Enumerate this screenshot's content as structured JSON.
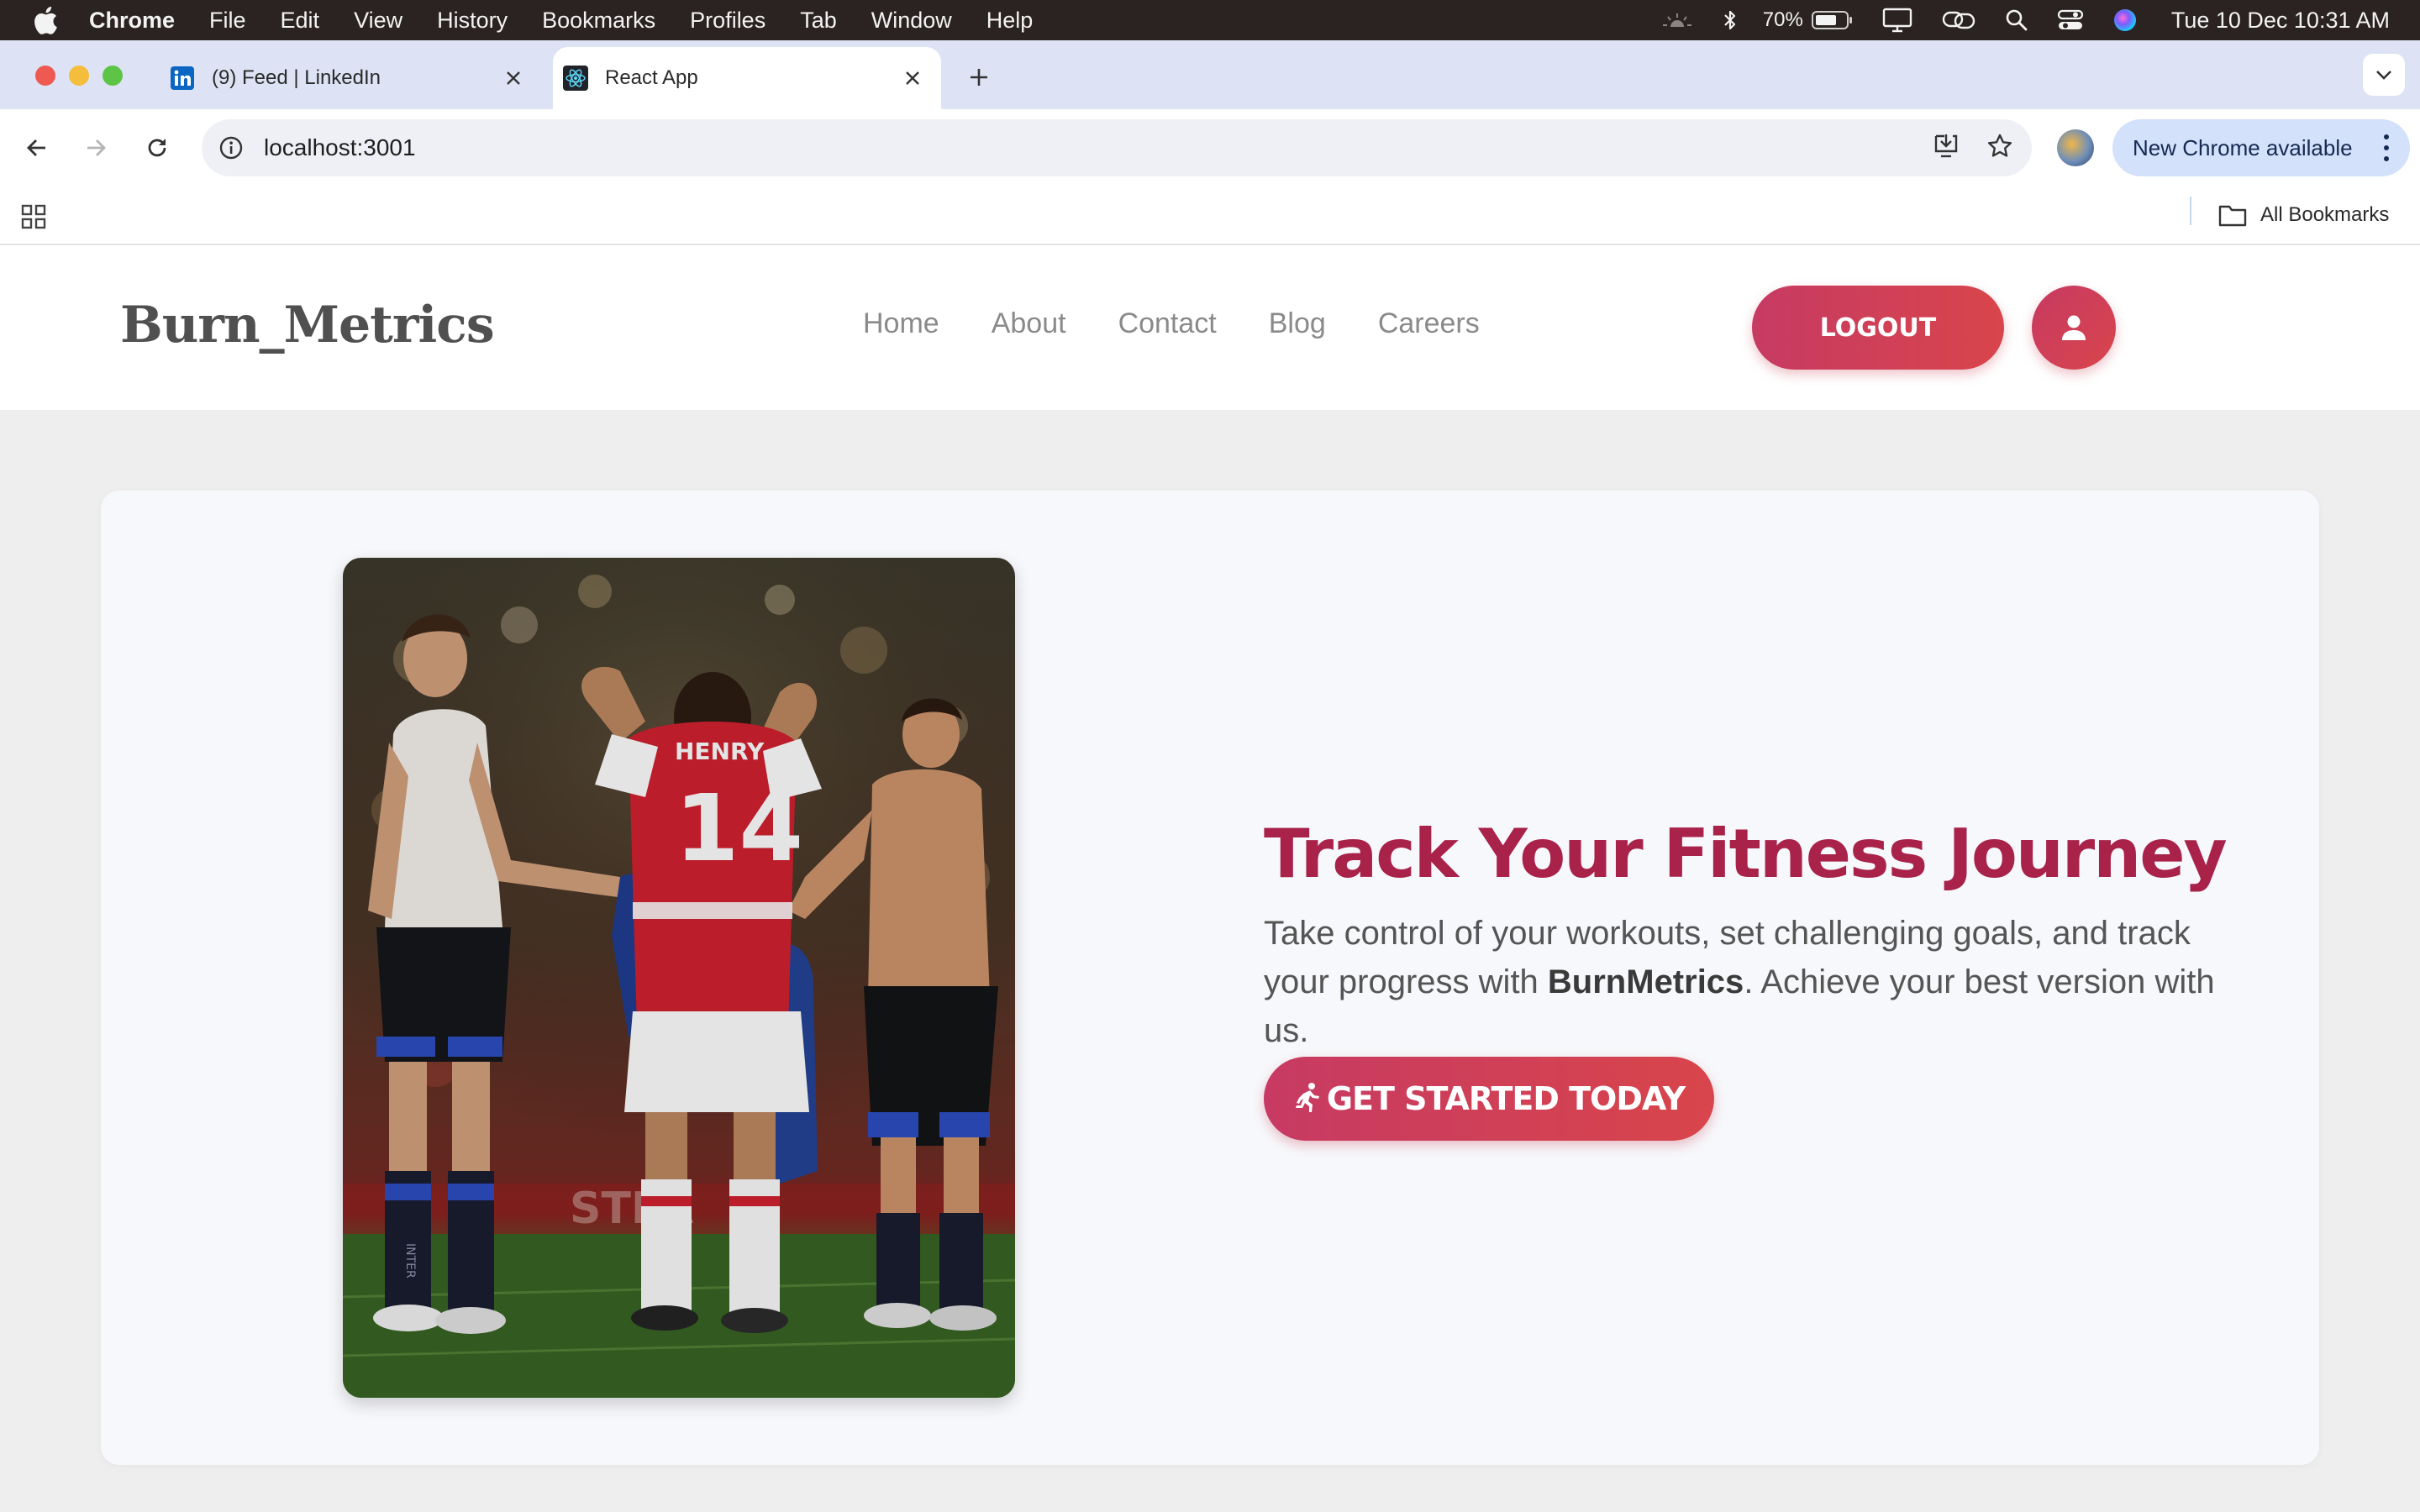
{
  "menubar": {
    "app": "Chrome",
    "items": [
      "File",
      "Edit",
      "View",
      "History",
      "Bookmarks",
      "Profiles",
      "Tab",
      "Window",
      "Help"
    ],
    "battery": "70%",
    "clock": "Tue 10 Dec  10:31 AM"
  },
  "tabs": [
    {
      "title": "(9) Feed | LinkedIn",
      "icon": "linkedin-icon",
      "active": false
    },
    {
      "title": "React App",
      "icon": "react-icon",
      "active": true
    }
  ],
  "toolbar": {
    "url": "localhost:3001",
    "update_label": "New Chrome available"
  },
  "bookmarks": {
    "all_label": "All Bookmarks"
  },
  "site": {
    "brand": "Burn_Metrics",
    "nav": [
      "Home",
      "About",
      "Contact",
      "Blog",
      "Careers"
    ],
    "logout_label": "LOGOUT"
  },
  "hero": {
    "title": "Track Your Fitness Journey",
    "text_before": "Take control of your workouts, set challenging goals, and track your progress with ",
    "text_brand": "BurnMetrics",
    "text_after": ". Achieve your best version with us.",
    "cta_label": "GET STARTED TODAY",
    "photo_jersey_name": "HENRY",
    "photo_jersey_number": "14",
    "photo_shorts_text": "INTER",
    "photo_board_text": "STER"
  },
  "colors": {
    "accent": "#c73a63",
    "title": "#a8224a",
    "menubar": "#2b2321",
    "tabstrip": "#dde3f4"
  }
}
